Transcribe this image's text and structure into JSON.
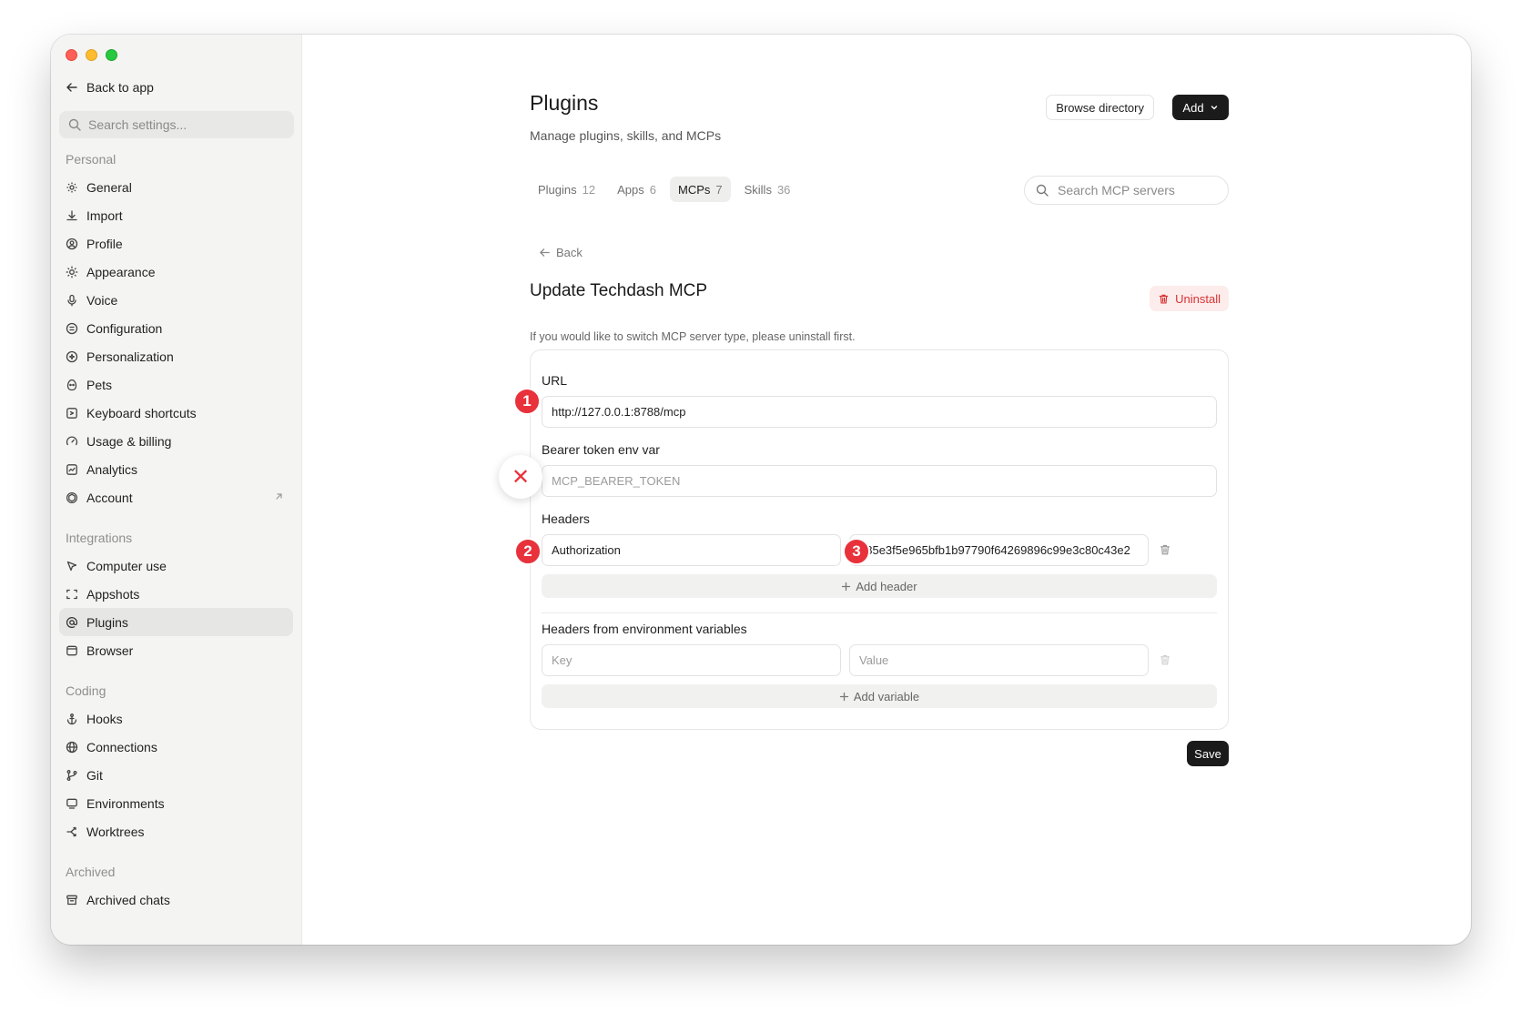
{
  "sidebar": {
    "back_label": "Back to app",
    "search_placeholder": "Search settings...",
    "sections": {
      "personal": "Personal",
      "integrations": "Integrations",
      "coding": "Coding",
      "archived": "Archived"
    },
    "items": {
      "general": "General",
      "import": "Import",
      "profile": "Profile",
      "appearance": "Appearance",
      "voice": "Voice",
      "configuration": "Configuration",
      "personalization": "Personalization",
      "pets": "Pets",
      "keyboard_shortcuts": "Keyboard shortcuts",
      "usage_billing": "Usage & billing",
      "analytics": "Analytics",
      "account": "Account",
      "computer_use": "Computer use",
      "appshots": "Appshots",
      "plugins": "Plugins",
      "browser": "Browser",
      "hooks": "Hooks",
      "connections": "Connections",
      "git": "Git",
      "environments": "Environments",
      "worktrees": "Worktrees",
      "archived_chats": "Archived chats"
    },
    "active_item": "Plugins"
  },
  "header": {
    "title": "Plugins",
    "subtitle": "Manage plugins, skills, and MCPs",
    "browse_label": "Browse directory",
    "add_label": "Add"
  },
  "tabs": [
    {
      "label": "Plugins",
      "count": "12"
    },
    {
      "label": "Apps",
      "count": "6"
    },
    {
      "label": "MCPs",
      "count": "7"
    },
    {
      "label": "Skills",
      "count": "36"
    }
  ],
  "active_tab": "MCPs",
  "search_mcp": {
    "placeholder": "Search MCP servers"
  },
  "detail": {
    "back_label": "Back",
    "title": "Update Techdash MCP",
    "uninstall_label": "Uninstall",
    "hint": "If you would like to switch MCP server type, please uninstall first.",
    "url_label": "URL",
    "url_value": "http://127.0.0.1:8788/mcp",
    "bearer_label": "Bearer token env var",
    "bearer_placeholder": "MCP_BEARER_TOKEN",
    "headers_label": "Headers",
    "header_key": "Authorization",
    "header_value": "385e3f5e965bfb1b97790f64269896c99e3c80c43e2",
    "add_header_label": "Add header",
    "env_headers_label": "Headers from environment variables",
    "env_key_placeholder": "Key",
    "env_value_placeholder": "Value",
    "add_variable_label": "Add variable",
    "save_label": "Save"
  },
  "annotations": {
    "badge_1": "1",
    "badge_2": "2",
    "badge_3": "3",
    "x_mark": "✕",
    "badge_color": "#e8313a"
  }
}
